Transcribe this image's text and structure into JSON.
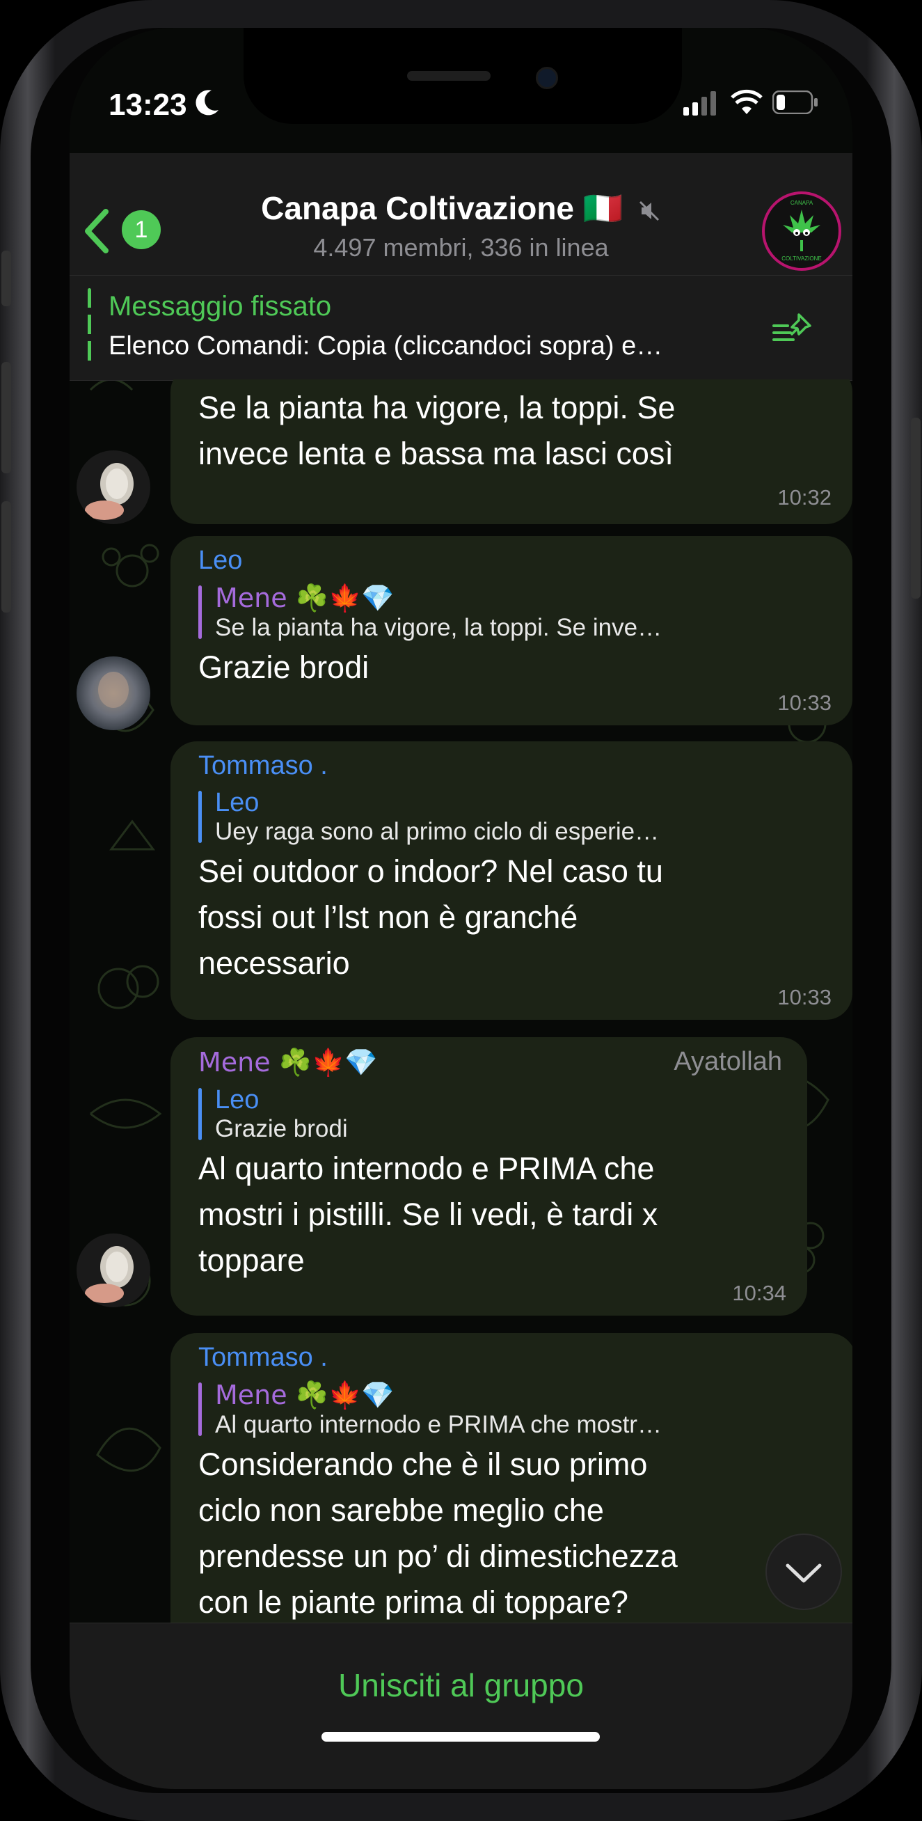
{
  "status_bar": {
    "time": "13:23"
  },
  "header": {
    "title": "Canapa Coltivazione 🇮🇹",
    "subtitle": "4.497 membri, 336 in linea",
    "back_badge": "1",
    "avatar_text_top": "CANAPA",
    "avatar_text_bottom": "COLTIVAZIONE"
  },
  "pinned": {
    "title": "Messaggio fissato",
    "text": "Elenco Comandi: Copia (cliccandoci sopra) e…"
  },
  "messages": [
    {
      "sender": "",
      "text_lines": [
        "Se la pianta ha vigore, la toppi. Se",
        "invece lenta e bassa ma lasci così"
      ],
      "time": "10:32"
    },
    {
      "sender": "Leo",
      "reply_name": "Mene ☘️🍁💎",
      "reply_text": "Se la pianta ha vigore, la toppi. Se inve…",
      "text_lines": [
        "Grazie brodi"
      ],
      "time": "10:33"
    },
    {
      "sender": "Tommaso .",
      "reply_name": "Leo",
      "reply_text": "Uey raga sono al primo ciclo di esperie…",
      "text_lines": [
        "Sei outdoor o indoor? Nel caso tu",
        "fossi out l’lst non è granché",
        "necessario"
      ],
      "time": "10:33"
    },
    {
      "sender": "Mene ☘️🍁💎",
      "rank": "Ayatollah",
      "reply_name": "Leo",
      "reply_text": "Grazie brodi",
      "text_lines": [
        "Al quarto internodo e PRIMA che",
        "mostri i pistilli. Se li vedi, è tardi x",
        "toppare"
      ],
      "time": "10:34"
    },
    {
      "sender": "Tommaso .",
      "reply_name": "Mene ☘️🍁💎",
      "reply_text": "Al quarto internodo e PRIMA che mostr…",
      "text_lines": [
        "Considerando che è il suo primo",
        "ciclo non sarebbe meglio che",
        "prendesse un po’ di dimestichezza",
        "con le piante prima di toppare?"
      ]
    }
  ],
  "join": {
    "label": "Unisciti al gruppo"
  },
  "colors": {
    "accent": "#4fc957",
    "bubble": "#1c2316",
    "name_blue": "#4a8ff5",
    "name_purple": "#a56bdc"
  }
}
